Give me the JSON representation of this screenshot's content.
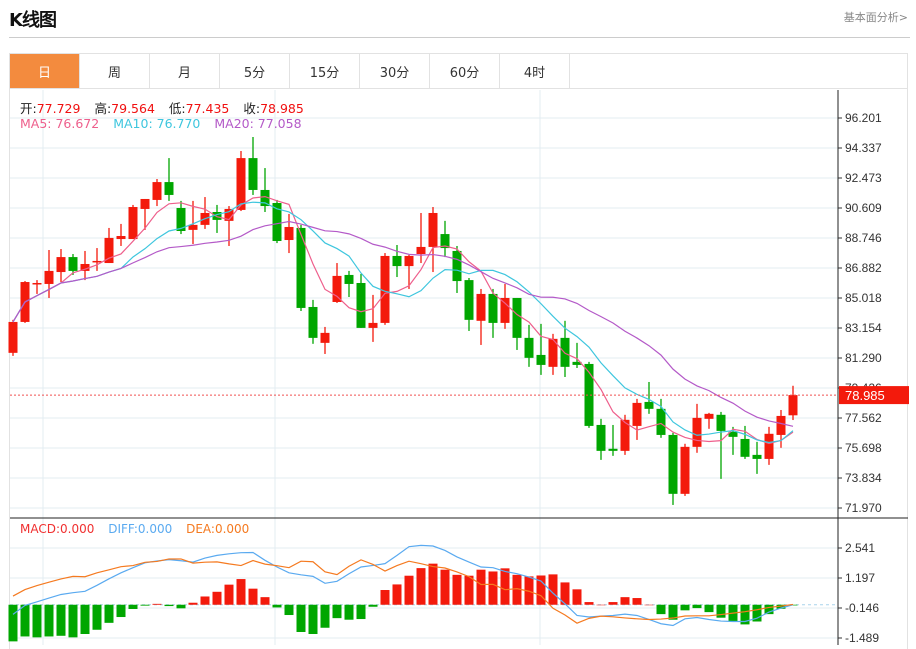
{
  "header": {
    "title": "K线图",
    "fundamental_link": "基本面分析>"
  },
  "tabs": [
    {
      "label": "日",
      "active": true
    },
    {
      "label": "周"
    },
    {
      "label": "月"
    },
    {
      "label": "5分"
    },
    {
      "label": "15分"
    },
    {
      "label": "30分"
    },
    {
      "label": "60分"
    },
    {
      "label": "4时"
    }
  ],
  "ohlc_info": {
    "open_label": "开:",
    "open": "77.729",
    "high_label": "高:",
    "high": "79.564",
    "low_label": "低:",
    "low": "77.435",
    "close_label": "收:",
    "close": "78.985"
  },
  "ma_info": {
    "ma5": "MA5: 76.672",
    "ma10": "MA10: 76.770",
    "ma20": "MA20: 77.058"
  },
  "macd_info": {
    "macd": "MACD:0.000",
    "diff": "DIFF:0.000",
    "dea": "DEA:0.000"
  },
  "colors": {
    "up": "#f31a0c",
    "down": "#00a600",
    "ma5": "#ee5f8c",
    "ma10": "#3ec6de",
    "ma20": "#b45ac8",
    "diff": "#5aaaf0",
    "dea": "#f57a20"
  },
  "chart_data": {
    "type": "candlestick",
    "price_axis": {
      "ticks": [
        "96.201",
        "94.337",
        "92.473",
        "90.609",
        "88.746",
        "86.882",
        "85.018",
        "83.154",
        "81.290",
        "79.426",
        "77.562",
        "75.698",
        "73.834",
        "71.970"
      ],
      "range": [
        71.97,
        96.201
      ]
    },
    "last_price": "78.985",
    "candles": [
      [
        81.61,
        83.53,
        83.66,
        81.42
      ],
      [
        83.53,
        86.01,
        86.07,
        83.47
      ],
      [
        85.95,
        85.95,
        86.13,
        85.27
      ],
      [
        85.89,
        86.7,
        88.0,
        85.02
      ],
      [
        86.63,
        87.56,
        88.06,
        86.01
      ],
      [
        87.56,
        86.7,
        87.75,
        86.45
      ],
      [
        86.7,
        87.13,
        87.94,
        86.13
      ],
      [
        87.25,
        87.32,
        88.12,
        86.7
      ],
      [
        87.19,
        88.75,
        89.37,
        87.19
      ],
      [
        88.68,
        88.87,
        89.62,
        88.25
      ],
      [
        88.68,
        90.67,
        90.8,
        88.68
      ],
      [
        90.55,
        91.17,
        91.17,
        89.25
      ],
      [
        91.11,
        92.22,
        92.41,
        90.73
      ],
      [
        92.22,
        91.42,
        93.71,
        91.05
      ],
      [
        90.61,
        89.18,
        91.05,
        88.99
      ],
      [
        89.25,
        89.56,
        91.05,
        88.37
      ],
      [
        89.56,
        90.3,
        91.29,
        89.31
      ],
      [
        90.36,
        89.87,
        90.8,
        89.06
      ],
      [
        89.81,
        90.55,
        90.73,
        88.25
      ],
      [
        90.49,
        93.71,
        94.15,
        90.42
      ],
      [
        93.71,
        91.73,
        95.02,
        91.42
      ],
      [
        91.73,
        90.73,
        93.09,
        90.36
      ],
      [
        90.92,
        88.56,
        91.11,
        88.43
      ],
      [
        88.62,
        89.43,
        90.24,
        87.81
      ],
      [
        89.37,
        84.4,
        89.56,
        84.21
      ],
      [
        84.46,
        82.54,
        84.9,
        82.17
      ],
      [
        82.23,
        82.85,
        83.22,
        81.54
      ],
      [
        84.77,
        86.39,
        87.19,
        84.71
      ],
      [
        86.45,
        85.89,
        86.7,
        85.08
      ],
      [
        85.95,
        83.16,
        86.51,
        83.16
      ],
      [
        83.16,
        83.47,
        85.21,
        82.29
      ],
      [
        83.47,
        87.63,
        87.81,
        83.35
      ],
      [
        87.63,
        87.0,
        88.31,
        86.32
      ],
      [
        87.0,
        87.63,
        87.69,
        85.58
      ],
      [
        87.75,
        88.19,
        90.3,
        87.19
      ],
      [
        88.19,
        90.3,
        90.67,
        86.63
      ],
      [
        88.99,
        88.12,
        89.81,
        87.56
      ],
      [
        87.94,
        86.07,
        88.25,
        85.33
      ],
      [
        86.13,
        83.66,
        86.26,
        82.97
      ],
      [
        83.6,
        85.27,
        85.58,
        82.1
      ],
      [
        85.27,
        83.47,
        85.58,
        82.54
      ],
      [
        83.47,
        85.02,
        85.89,
        83.1
      ],
      [
        85.02,
        82.54,
        85.02,
        81.79
      ],
      [
        82.54,
        81.3,
        83.35,
        80.74
      ],
      [
        81.48,
        80.86,
        83.41,
        80.24
      ],
      [
        80.74,
        82.48,
        82.79,
        80.24
      ],
      [
        82.54,
        80.74,
        83.6,
        80.11
      ],
      [
        81.05,
        80.86,
        82.23,
        80.67
      ],
      [
        80.92,
        77.07,
        81.05,
        76.95
      ],
      [
        77.13,
        75.52,
        77.51,
        74.96
      ],
      [
        75.65,
        75.52,
        77.13,
        75.21
      ],
      [
        75.52,
        77.45,
        77.76,
        75.27
      ],
      [
        77.07,
        78.5,
        78.75,
        76.2
      ],
      [
        78.56,
        78.13,
        79.8,
        77.82
      ],
      [
        78.13,
        76.51,
        78.75,
        76.33
      ],
      [
        76.51,
        72.85,
        76.64,
        72.16
      ],
      [
        72.85,
        75.77,
        75.96,
        72.72
      ],
      [
        75.77,
        77.57,
        78.44,
        75.4
      ],
      [
        77.51,
        77.82,
        77.88,
        76.89
      ],
      [
        77.76,
        76.76,
        77.94,
        73.78
      ],
      [
        76.7,
        76.39,
        77.01,
        75.27
      ],
      [
        76.26,
        75.15,
        77.07,
        75.02
      ],
      [
        75.27,
        75.02,
        76.08,
        74.09
      ],
      [
        75.02,
        76.58,
        77.01,
        74.65
      ],
      [
        76.51,
        77.69,
        78.06,
        75.71
      ],
      [
        77.729,
        78.985,
        79.564,
        77.435
      ]
    ],
    "macd_axis": {
      "ticks": [
        "2.541",
        "1.197",
        "-0.146",
        "-1.489"
      ],
      "range": [
        -1.489,
        2.541
      ]
    },
    "macd": [
      -1.64,
      -1.42,
      -1.46,
      -1.42,
      -1.39,
      -1.46,
      -1.31,
      -1.12,
      -0.81,
      -0.55,
      -0.19,
      -0.04,
      0.04,
      -0.06,
      -0.16,
      0.09,
      0.37,
      0.58,
      0.9,
      1.15,
      0.72,
      0.34,
      -0.12,
      -0.46,
      -1.22,
      -1.31,
      -1.03,
      -0.6,
      -0.67,
      -0.64,
      -0.09,
      0.66,
      0.91,
      1.3,
      1.64,
      1.84,
      1.57,
      1.34,
      1.3,
      1.57,
      1.49,
      1.63,
      1.34,
      1.27,
      1.31,
      1.36,
      1.0,
      0.69,
      0.12,
      0.0,
      0.12,
      0.34,
      0.3,
      0.0,
      -0.42,
      -0.67,
      -0.25,
      -0.15,
      -0.33,
      -0.58,
      -0.75,
      -0.88,
      -0.75,
      -0.42,
      -0.18,
      -0.03
    ],
    "diff": [
      -0.43,
      -0.03,
      0.13,
      0.3,
      0.46,
      0.54,
      0.6,
      0.87,
      1.16,
      1.43,
      1.66,
      1.88,
      1.96,
      2.02,
      1.97,
      1.91,
      2.09,
      2.21,
      2.28,
      2.33,
      2.34,
      1.99,
      1.69,
      1.43,
      1.34,
      1.27,
      0.96,
      1.05,
      1.39,
      1.69,
      1.76,
      1.84,
      2.21,
      2.6,
      2.66,
      2.63,
      2.43,
      2.14,
      1.91,
      1.69,
      1.66,
      1.49,
      1.39,
      1.24,
      1.06,
      0.52,
      0.04,
      -0.48,
      -0.55,
      -0.51,
      -0.48,
      -0.42,
      -0.48,
      -0.66,
      -0.85,
      -0.93,
      -0.63,
      -0.57,
      -0.66,
      -0.73,
      -0.75,
      -0.75,
      -0.6,
      -0.33,
      -0.15,
      0.0
    ]
  }
}
